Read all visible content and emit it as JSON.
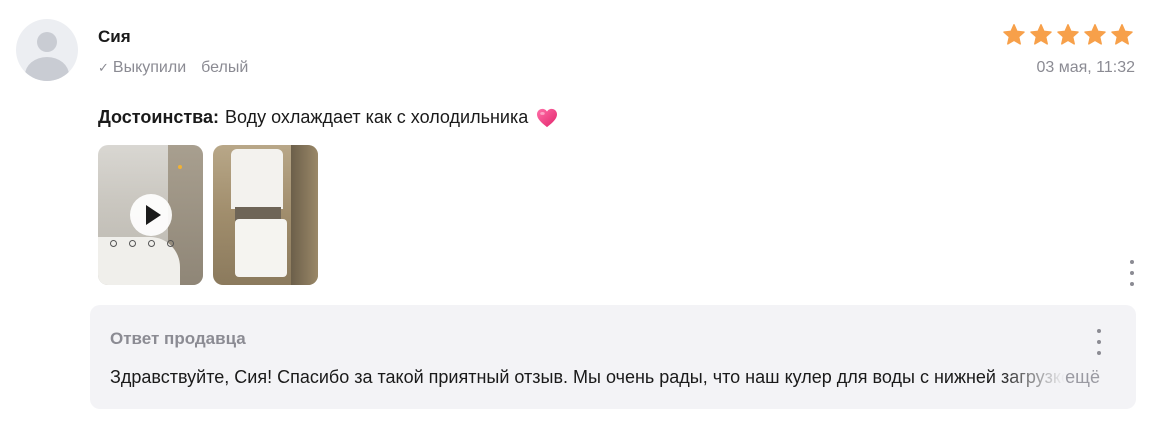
{
  "review": {
    "author": "Сия",
    "purchased_label": "Выкупили",
    "variant": "белый",
    "date": "03 мая, 11:32",
    "rating": 5,
    "star_color": "#f7a04a",
    "pros_label": "Достоинства:",
    "pros_text": "Воду охлаждает как с холодильника",
    "emoji_icon": "heart-icon",
    "photos": [
      {
        "type": "video",
        "icon": "play-icon"
      },
      {
        "type": "image"
      }
    ]
  },
  "seller_reply": {
    "title": "Ответ продавца",
    "text": "Здравствуйте, Сия! Спасибо за такой приятный отзыв. Мы очень рады, что наш кулер для воды с нижней загрузкой",
    "more_label": "ещё"
  }
}
